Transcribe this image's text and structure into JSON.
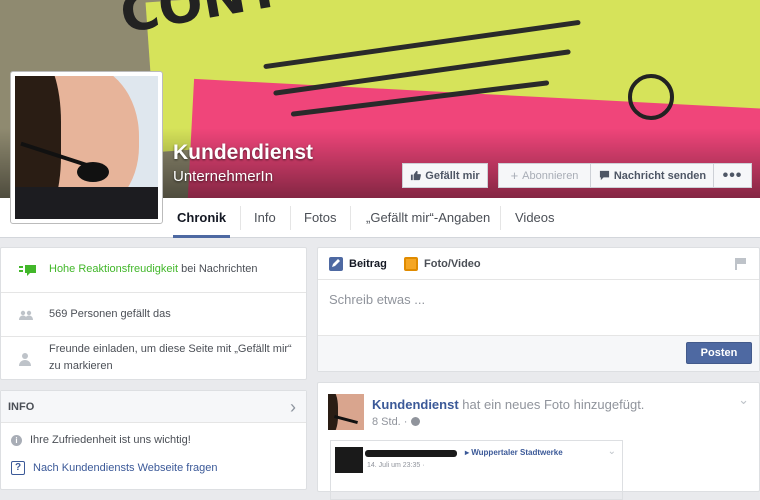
{
  "page": {
    "name": "Kundendienst",
    "category": "UnternehmerIn"
  },
  "actions": {
    "like": "Gefällt mir",
    "follow": "Abonnieren",
    "message": "Nachricht senden",
    "more": "•••"
  },
  "tabs": [
    "Chronik",
    "Info",
    "Fotos",
    "„Gefällt mir“-Angaben",
    "Videos"
  ],
  "sidebar": {
    "responsiveness_badge": "Hohe Reaktionsfreudigkeit",
    "responsiveness_rest": " bei Nachrichten",
    "likes": "569 Personen gefällt das",
    "invite": "Freunde einladen, um diese Seite mit „Gefällt mir“ zu markieren"
  },
  "info": {
    "header": "INFO",
    "about": "Ihre Zufriedenheit ist uns wichtig!",
    "ask": "Nach Kundendiensts Webseite fragen"
  },
  "composer": {
    "tab_post": "Beitrag",
    "tab_photo": "Foto/Video",
    "placeholder": "Schreib etwas ...",
    "post_button": "Posten"
  },
  "story": {
    "author": "Kundendienst",
    "action": " hat ein neues Foto hinzugefügt.",
    "time": "8 Std. ·",
    "embedded": {
      "page": "Wuppertaler Stadtwerke",
      "date": "14. Juli um 23:35 ·"
    }
  },
  "colors": {
    "brand": "#3b5998",
    "button": "#4e69a2",
    "green": "#42b72a"
  }
}
